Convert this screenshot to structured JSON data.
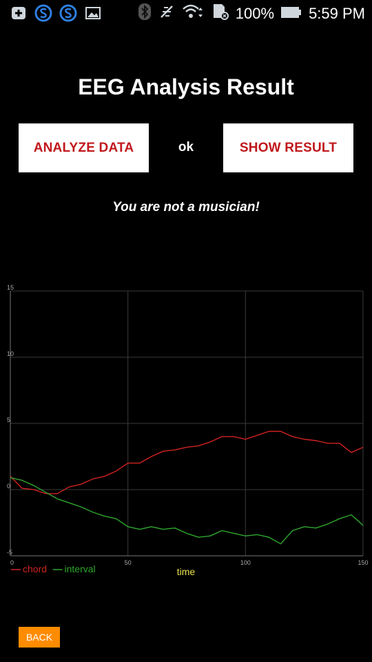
{
  "statusbar": {
    "battery": "100%",
    "time": "5:59 PM"
  },
  "page": {
    "title": "EEG Analysis Result",
    "analyze_label": "ANALYZE DATA",
    "ok_label": "ok",
    "show_label": "SHOW RESULT",
    "verdict": "You are not a musician!",
    "back_label": "BACK"
  },
  "colors": {
    "chord": "#d0231f",
    "interval": "#2ea82e",
    "xlabel": "#e8e24a",
    "button_text": "#c0171c",
    "back_bg": "#ff8c00"
  },
  "chart_data": {
    "type": "line",
    "xlabel": "time",
    "ylabel": "",
    "xlim": [
      0,
      150
    ],
    "ylim": [
      -5,
      15
    ],
    "xticks": [
      0,
      50,
      100,
      150
    ],
    "yticks": [
      -5,
      0,
      5,
      10,
      15
    ],
    "grid": true,
    "legend": "bottom-left",
    "series": [
      {
        "name": "chord",
        "x": [
          0,
          5,
          10,
          15,
          20,
          25,
          30,
          35,
          40,
          45,
          50,
          55,
          60,
          65,
          70,
          75,
          80,
          85,
          90,
          95,
          100,
          105,
          110,
          115,
          120,
          125,
          130,
          135,
          140,
          145,
          150
        ],
        "y": [
          1.0,
          0.1,
          0.0,
          -0.3,
          -0.3,
          0.2,
          0.4,
          0.8,
          1.0,
          1.4,
          2.0,
          2.0,
          2.5,
          2.9,
          3.0,
          3.2,
          3.3,
          3.6,
          4.0,
          4.0,
          3.8,
          4.1,
          4.4,
          4.4,
          4.0,
          3.8,
          3.7,
          3.5,
          3.5,
          2.8,
          3.2
        ]
      },
      {
        "name": "interval",
        "x": [
          0,
          5,
          10,
          15,
          20,
          25,
          30,
          35,
          40,
          45,
          50,
          55,
          60,
          65,
          70,
          75,
          80,
          85,
          90,
          95,
          100,
          105,
          110,
          115,
          120,
          125,
          130,
          135,
          140,
          145,
          150
        ],
        "y": [
          0.9,
          0.7,
          0.3,
          -0.2,
          -0.7,
          -1.0,
          -1.3,
          -1.7,
          -2.0,
          -2.2,
          -2.8,
          -3.0,
          -2.8,
          -3.0,
          -2.9,
          -3.3,
          -3.6,
          -3.5,
          -3.1,
          -3.3,
          -3.5,
          -3.4,
          -3.6,
          -4.1,
          -3.1,
          -2.8,
          -2.9,
          -2.6,
          -2.2,
          -1.9,
          -2.7
        ]
      }
    ]
  }
}
